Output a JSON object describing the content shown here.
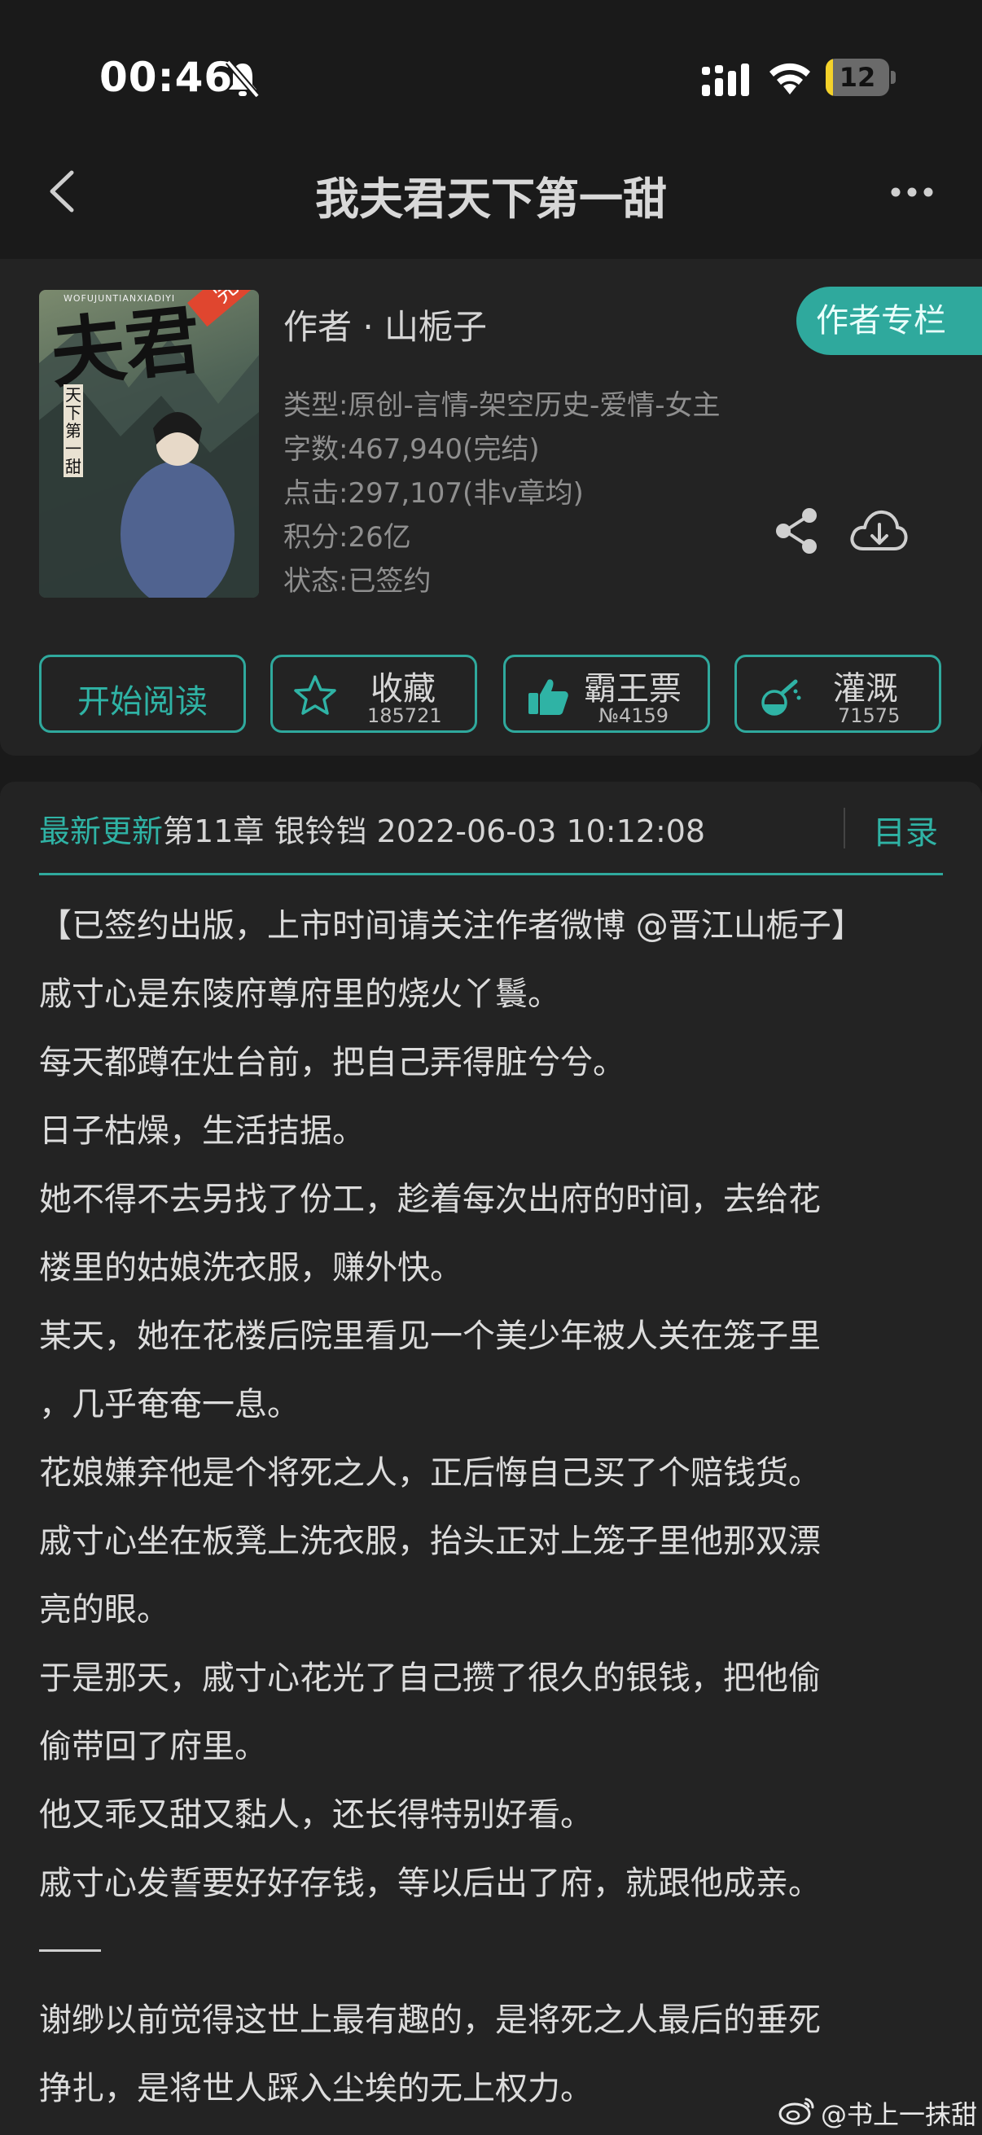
{
  "status_bar": {
    "time": "00:46",
    "battery_level": "12",
    "battery_fraction": 0.12
  },
  "header": {
    "title": "我夫君天下第一甜",
    "back_icon": "chevron-left-icon",
    "more_icon": "more-dots-icon"
  },
  "book": {
    "cover_title": "夫君",
    "cover_subtitle": "天下第一甜",
    "cover_badge": "完结",
    "cover_top_text": "WOFUJUNTIANXIADIYI",
    "author_line": "作者 · 山栀子",
    "author_column_label": "作者专栏",
    "meta": {
      "genre": "类型:原创-言情-架空历史-爱情-女主",
      "word_count": "字数:467,940(完结)",
      "clicks": "点击:297,107(非v章均)",
      "score": "积分:26亿",
      "status": "状态:已签约"
    }
  },
  "actions": {
    "read_label": "开始阅读",
    "collect_label": "收藏",
    "collect_count": "185721",
    "ticket_label": "霸王票",
    "ticket_count": "№4159",
    "water_label": "灌溉",
    "water_count": "71575"
  },
  "update": {
    "label": "最新更新",
    "chapter": "第11章 银铃铛 2022-06-03 10:12:08",
    "toc_label": "目录"
  },
  "synopsis": [
    "【已签约出版，上市时间请关注作者微博 @晋江山栀子】",
    "戚寸心是东陵府尊府里的烧火丫鬟。",
    "每天都蹲在灶台前，把自己弄得脏兮兮。",
    "日子枯燥，生活拮据。",
    "她不得不去另找了份工，趁着每次出府的时间，去给花",
    "楼里的姑娘洗衣服，赚外快。",
    "某天，她在花楼后院里看见一个美少年被人关在笼子里",
    "，几乎奄奄一息。",
    "花娘嫌弃他是个将死之人，正后悔自己买了个赔钱货。",
    "戚寸心坐在板凳上洗衣服，抬头正对上笼子里他那双漂",
    "亮的眼。",
    "于是那天，戚寸心花光了自己攒了很久的银钱，把他偷",
    "偷带回了府里。",
    "他又乖又甜又黏人，还长得特别好看。",
    "戚寸心发誓要好好存钱，等以后出了府，就跟他成亲。",
    "",
    "谢缈以前觉得这世上最有趣的，是将死之人最后的垂死",
    "挣扎，是将世人踩入尘埃的无上权力。"
  ],
  "watermark": {
    "text": "@书上一抹甜"
  },
  "colors": {
    "accent": "#2fa99d",
    "background": "#1a1a1a",
    "card": "#232323"
  }
}
